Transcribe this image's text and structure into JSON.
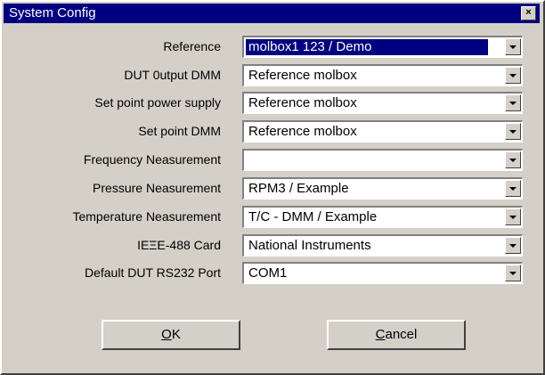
{
  "window": {
    "title": "System Config",
    "close_glyph": "×"
  },
  "fields": [
    {
      "label": "Reference",
      "value": "molbox1 123 / Demo",
      "selected": true
    },
    {
      "label": "DUT 0utput DMM",
      "value": "Reference molbox"
    },
    {
      "label": "Set point power supply",
      "value": "Reference molbox"
    },
    {
      "label": "Set point DMM",
      "value": "Reference molbox"
    },
    {
      "label": "Frequency Neasurement",
      "value": ""
    },
    {
      "label": "Pressure Neasurement",
      "value": "RPM3  / Example"
    },
    {
      "label": "Temperature Neasurement",
      "value": "T/C - DMM  / Example"
    },
    {
      "label": "IEΞE-488 Card",
      "value": "National Instruments"
    },
    {
      "label": "Default DUT RS232 Port",
      "value": "COM1"
    }
  ],
  "buttons": {
    "ok_label": "OK",
    "ok_mnemonic": "O",
    "ok_rest": "K",
    "cancel_label": "Cancel",
    "cancel_mnemonic": "C",
    "cancel_rest": "ancel"
  },
  "colors": {
    "titlebar": "#000080",
    "dialog_bg": "#d4d0c8",
    "selection": "#000080"
  },
  "icons": {
    "close": "close-icon",
    "dropdown": "chevron-down-icon"
  }
}
